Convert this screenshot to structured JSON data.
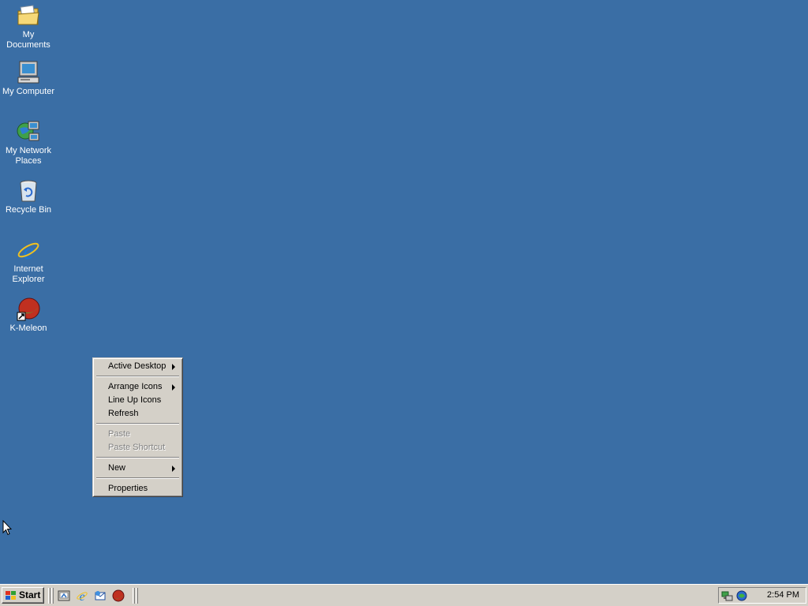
{
  "desktop": {
    "background_color": "#3a6ea5",
    "icons": [
      {
        "label": "My Documents",
        "icon": "folder-documents-icon"
      },
      {
        "label": "My Computer",
        "icon": "computer-icon"
      },
      {
        "label": "My Network Places",
        "icon": "network-places-icon"
      },
      {
        "label": "Recycle Bin",
        "icon": "recycle-bin-icon"
      },
      {
        "label": "Internet Explorer",
        "icon": "internet-explorer-icon"
      },
      {
        "label": "K-Meleon",
        "icon": "k-meleon-icon"
      }
    ]
  },
  "context_menu": {
    "items": [
      {
        "label": "Active Desktop",
        "submenu": true,
        "enabled": true
      },
      {
        "label": "Arrange Icons",
        "submenu": true,
        "enabled": true
      },
      {
        "label": "Line Up Icons",
        "submenu": false,
        "enabled": true
      },
      {
        "label": "Refresh",
        "submenu": false,
        "enabled": true
      },
      {
        "label": "Paste",
        "submenu": false,
        "enabled": false
      },
      {
        "label": "Paste Shortcut",
        "submenu": false,
        "enabled": false
      },
      {
        "label": "New",
        "submenu": true,
        "enabled": true
      },
      {
        "label": "Properties",
        "submenu": false,
        "enabled": true
      }
    ]
  },
  "taskbar": {
    "start_label": "Start",
    "quick_launch": [
      "show-desktop-icon",
      "internet-explorer-icon",
      "outlook-express-icon",
      "k-meleon-icon"
    ],
    "tray_icons": [
      "network-connection-icon",
      "volume-icon"
    ],
    "clock": "2:54 PM"
  }
}
